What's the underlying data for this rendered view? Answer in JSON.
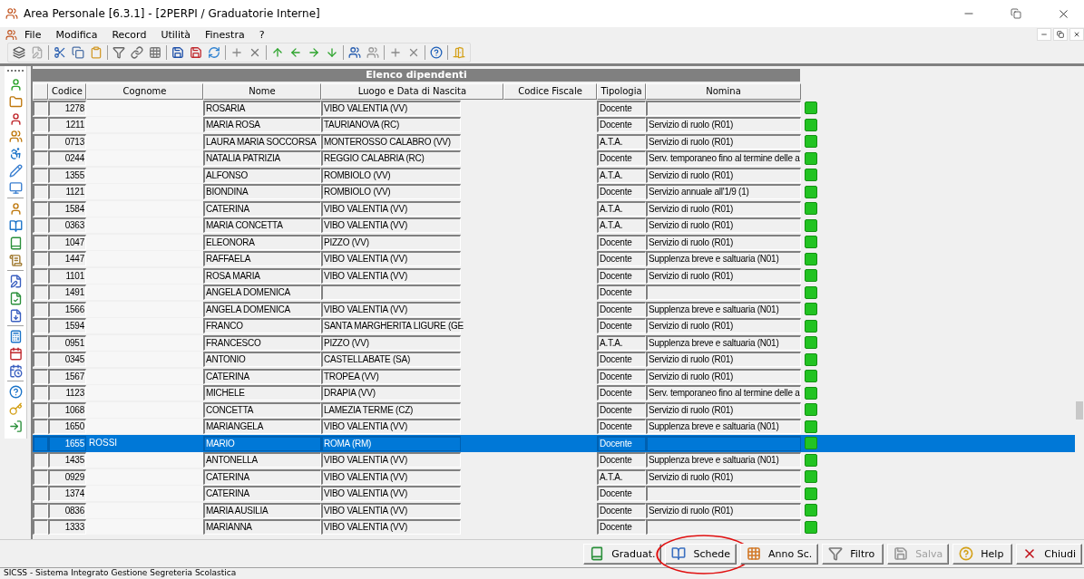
{
  "window": {
    "title": "Area Personale [6.3.1] - [2PERPI / Graduatorie Interne]"
  },
  "menu": [
    "File",
    "Modifica",
    "Record",
    "Utilità",
    "Finestra",
    "?"
  ],
  "grid": {
    "title": "Elenco dipendenti",
    "columns": [
      "Codice",
      "Cognome",
      "Nome",
      "Luogo e Data di Nascita",
      "Codice Fiscale",
      "Tipologia",
      "Nomina"
    ],
    "rows": [
      {
        "codice": "1278",
        "nome": "ROSARIA",
        "luogo": "VIBO VALENTIA (VV)",
        "tipologia": "Docente",
        "selected": false
      },
      {
        "codice": "1211",
        "nome": "MARIA ROSA",
        "luogo": "TAURIANOVA (RC)",
        "tipologia": "Docente",
        "nomina": "Servizio di ruolo (R01)",
        "selected": false
      },
      {
        "codice": "0713",
        "nome": "LAURA MARIA SOCCORSA",
        "luogo": "MONTEROSSO CALABRO (VV)",
        "tipologia": "A.T.A.",
        "nomina": "Servizio di ruolo (R01)",
        "selected": false
      },
      {
        "codice": "0244",
        "nome": "NATALIA PATRIZIA",
        "luogo": "REGGIO CALABRIA (RC)",
        "tipologia": "Docente",
        "nomina": "Serv. temporaneo fino al termine delle a",
        "selected": false
      },
      {
        "codice": "1355",
        "nome": "ALFONSO",
        "luogo": "ROMBIOLO (VV)",
        "tipologia": "A.T.A.",
        "nomina": "Servizio di ruolo (R01)",
        "selected": false
      },
      {
        "codice": "1121",
        "nome": "BIONDINA",
        "luogo": "ROMBIOLO (VV)",
        "tipologia": "Docente",
        "nomina": "Servizio annuale all'1/9 (1)",
        "selected": false
      },
      {
        "codice": "1584",
        "nome": "CATERINA",
        "luogo": "VIBO VALENTIA (VV)",
        "tipologia": "A.T.A.",
        "nomina": "Servizio di ruolo (R01)",
        "selected": false
      },
      {
        "codice": "0363",
        "nome": "MARIA CONCETTA",
        "luogo": "VIBO VALENTIA (VV)",
        "tipologia": "A.T.A.",
        "nomina": "Servizio di ruolo (R01)",
        "selected": false
      },
      {
        "codice": "1047",
        "nome": "ELEONORA",
        "luogo": "PIZZO (VV)",
        "tipologia": "Docente",
        "nomina": "Servizio di ruolo (R01)",
        "selected": false
      },
      {
        "codice": "1447",
        "nome": "RAFFAELA",
        "luogo": "VIBO VALENTIA (VV)",
        "tipologia": "Docente",
        "nomina": "Supplenza breve e saltuaria (N01)",
        "selected": false
      },
      {
        "codice": "1101",
        "nome": "ROSA MARIA",
        "luogo": "VIBO VALENTIA (VV)",
        "tipologia": "Docente",
        "nomina": "Servizio di ruolo (R01)",
        "selected": false
      },
      {
        "codice": "1491",
        "nome": "ANGELA DOMENICA",
        "tipologia": "Docente",
        "selected": false
      },
      {
        "codice": "1566",
        "nome": "ANGELA DOMENICA",
        "luogo": "VIBO VALENTIA (VV)",
        "tipologia": "Docente",
        "nomina": "Supplenza breve e saltuaria (N01)",
        "selected": false
      },
      {
        "codice": "1594",
        "nome": "FRANCO",
        "luogo": "SANTA MARGHERITA LIGURE (GE",
        "tipologia": "Docente",
        "nomina": "Servizio di ruolo (R01)",
        "selected": false
      },
      {
        "codice": "0951",
        "nome": "FRANCESCO",
        "luogo": "PIZZO (VV)",
        "tipologia": "A.T.A.",
        "nomina": "Supplenza breve e saltuaria (N01)",
        "selected": false
      },
      {
        "codice": "0345",
        "nome": "ANTONIO",
        "luogo": "CASTELLABATE (SA)",
        "tipologia": "Docente",
        "nomina": "Servizio di ruolo (R01)",
        "selected": false
      },
      {
        "codice": "1567",
        "nome": "CATERINA",
        "luogo": "TROPEA (VV)",
        "tipologia": "Docente",
        "nomina": "Servizio di ruolo (R01)",
        "selected": false
      },
      {
        "codice": "1123",
        "nome": "MICHELE",
        "luogo": "DRAPIA (VV)",
        "tipologia": "Docente",
        "nomina": "Serv. temporaneo fino al termine delle a",
        "selected": false
      },
      {
        "codice": "1068",
        "nome": "CONCETTA",
        "luogo": "LAMEZIA TERME (CZ)",
        "tipologia": "Docente",
        "nomina": "Servizio di ruolo (R01)",
        "selected": false
      },
      {
        "codice": "1650",
        "nome": "MARIANGELA",
        "luogo": "VIBO VALENTIA (VV)",
        "tipologia": "Docente",
        "nomina": "Supplenza breve e saltuaria (N01)",
        "selected": false
      },
      {
        "codice": "1655",
        "cognome": "ROSSI",
        "nome": "MARIO",
        "luogo": "ROMA (RM)",
        "tipologia": "Docente",
        "selected": true
      },
      {
        "codice": "1435",
        "nome": "ANTONELLA",
        "luogo": "VIBO VALENTIA (VV)",
        "tipologia": "Docente",
        "nomina": "Supplenza breve e saltuaria (N01)",
        "selected": false
      },
      {
        "codice": "0929",
        "nome": "CATERINA",
        "luogo": "VIBO VALENTIA (VV)",
        "tipologia": "A.T.A.",
        "nomina": "Servizio di ruolo (R01)",
        "selected": false
      },
      {
        "codice": "1374",
        "nome": "CATERINA",
        "luogo": "VIBO VALENTIA (VV)",
        "tipologia": "Docente",
        "selected": false
      },
      {
        "codice": "0836",
        "nome": "MARIA AUSILIA",
        "luogo": "VIBO VALENTIA (VV)",
        "tipologia": "Docente",
        "nomina": "Servizio di ruolo (R01)",
        "selected": false
      },
      {
        "codice": "1333",
        "nome": "MARIANNA",
        "luogo": "VIBO VALENTIA (VV)",
        "tipologia": "Docente",
        "selected": false
      }
    ]
  },
  "buttons": [
    {
      "kind": "graduat",
      "label": "Graduat.",
      "disabled": false,
      "circled": false
    },
    {
      "kind": "schede",
      "label": "Schede",
      "disabled": false,
      "circled": true
    },
    {
      "kind": "anno",
      "label": "Anno Sc.",
      "disabled": false,
      "circled": false
    },
    {
      "kind": "filtro",
      "label": "Filtro",
      "disabled": false,
      "circled": false
    },
    {
      "kind": "salva",
      "label": "Salva",
      "disabled": true,
      "circled": false
    },
    {
      "kind": "help",
      "label": "Help",
      "disabled": false,
      "circled": false
    },
    {
      "kind": "chiudi",
      "label": "Chiudi",
      "disabled": false,
      "circled": false
    }
  ],
  "status_bar": "SICSS - Sistema Integrato Gestione Segreteria Scolastica"
}
